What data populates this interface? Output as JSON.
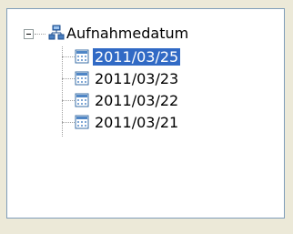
{
  "tree": {
    "root": {
      "label": "Aufnahmedatum",
      "icon": "tree-root-icon",
      "expanded": true
    },
    "children": [
      {
        "label": "2011/03/25",
        "icon": "calendar-icon",
        "selected": true
      },
      {
        "label": "2011/03/23",
        "icon": "calendar-icon",
        "selected": false
      },
      {
        "label": "2011/03/22",
        "icon": "calendar-icon",
        "selected": false
      },
      {
        "label": "2011/03/21",
        "icon": "calendar-icon",
        "selected": false
      }
    ]
  },
  "colors": {
    "selection": "#316ac5",
    "border": "#7f9db9",
    "background": "#ece9d8"
  }
}
